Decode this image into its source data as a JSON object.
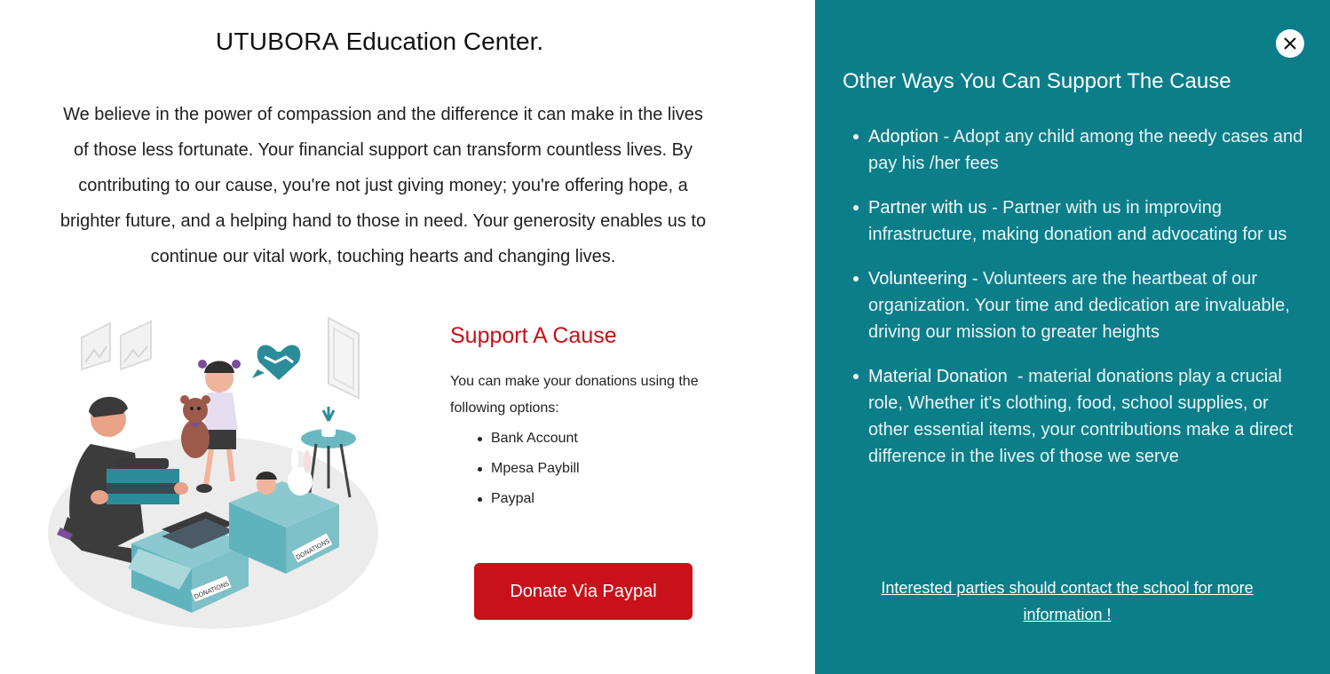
{
  "header": {
    "brand": "UTUBORA",
    "title_rest": " Education Center."
  },
  "intro": "We believe in the power of compassion and the difference it can make in the lives of those less fortunate. Your financial support can transform countless lives. By contributing to our cause, you're not just giving money; you're offering hope, a brighter future, and a helping hand to those in need. Your generosity enables us to continue our vital work, touching hearts and changing lives.",
  "illustration": {
    "box_label_1": "DONATIONS",
    "box_label_2": "DONATIONS"
  },
  "support": {
    "heading": "Support A Cause",
    "text": "You can make your donations using the following options:",
    "options": [
      "Bank Account",
      "Mpesa Paybill",
      "Paypal"
    ],
    "button_label": "Donate Via Paypal"
  },
  "panel": {
    "heading": "Other Ways You Can Support The Cause",
    "ways": [
      {
        "title": "Adoption",
        "separator": " - ",
        "text": "Adopt any child among the needy cases and pay his /her fees"
      },
      {
        "title": "Partner with us",
        "separator": " - ",
        "text": "Partner with us in improving infrastructure, making donation and advocating for us"
      },
      {
        "title": "Volunteering",
        "separator": " - ",
        "text": "Volunteers are the heartbeat of our organization. Your time and dedication are invaluable, driving our mission to greater heights"
      },
      {
        "title": "Material Donation",
        "separator": "  - ",
        "text": "material donations play a crucial role, Whether it's clothing, food, school supplies, or other essential items, your contributions make a direct difference in the lives of those we serve"
      }
    ],
    "contact_link": "Interested parties should contact the school for more information !"
  },
  "icons": {
    "close": "close-icon",
    "heart_handshake": "heart-handshake-icon",
    "picture_frame": "picture-frame-icon"
  },
  "colors": {
    "panel_bg": "#0b7e8a",
    "accent_red": "#c9111a",
    "illustration_teal": "#5fb3bd"
  }
}
